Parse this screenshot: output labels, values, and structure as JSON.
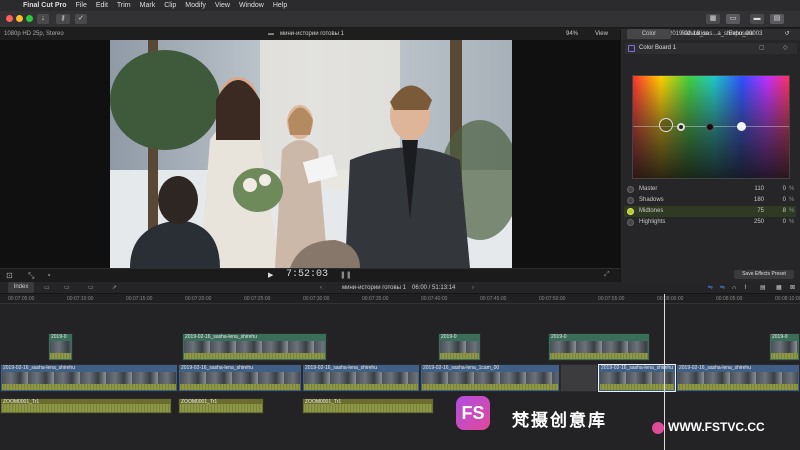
{
  "menubar": {
    "app": "Final Cut Pro",
    "items": [
      "File",
      "Edit",
      "Trim",
      "Mark",
      "Clip",
      "Modify",
      "View",
      "Window",
      "Help"
    ]
  },
  "viewer": {
    "format": "1080p HD 25p, Stereo",
    "project_title": "мини-истории готовы 1",
    "zoom": "94%",
    "view_menu": "View",
    "timecode": "7:52:03"
  },
  "inspector": {
    "clip_name": "2019-02-16_sas...a_shrehu_00003",
    "board": "Color Board 1",
    "tabs": [
      "Color",
      "Saturation",
      "Exposure"
    ],
    "rows": [
      {
        "name": "Master",
        "value": "110",
        "percent": "0"
      },
      {
        "name": "Shadows",
        "value": "180",
        "percent": "0"
      },
      {
        "name": "Midtones",
        "value": "75",
        "percent": "8"
      },
      {
        "name": "Highlights",
        "value": "250",
        "percent": "0"
      }
    ],
    "save_button": "Save Effects Preset"
  },
  "timeline": {
    "index_label": "Index",
    "project_title": "мини-истории готовы 1",
    "duration": "06:00 / 51:13:14",
    "ruler": [
      "00:07:05:00",
      "00:07:10:00",
      "00:07:15:00",
      "00:07:20:00",
      "00:07:25:00",
      "00:07:30:00",
      "00:07:35:00",
      "00:07:40:00",
      "00:07:45:00",
      "00:07:50:00",
      "00:07:55:00",
      "00:08:00:00",
      "00:08:05:00",
      "00:08:10:00"
    ],
    "clip_label_short": "2019-0",
    "clip_label_long": "2019-02-16_sasha-lena_shirehu",
    "clip_label_cam": "2019-02-16_sasha-lena_1cam_00",
    "audio_label": "ZOOM0001_Tr1"
  },
  "watermark": {
    "letters": "FS",
    "cn": "梵摄创意库",
    "url": "WWW.FSTVC.CC"
  },
  "colors": {
    "accent": "#3f7fe0",
    "connected_clip": "#3a6e58",
    "primary_clip": "#3f5f86",
    "audio_clip": "#6a6d2c",
    "watermark_pink": "#e04a9a"
  }
}
